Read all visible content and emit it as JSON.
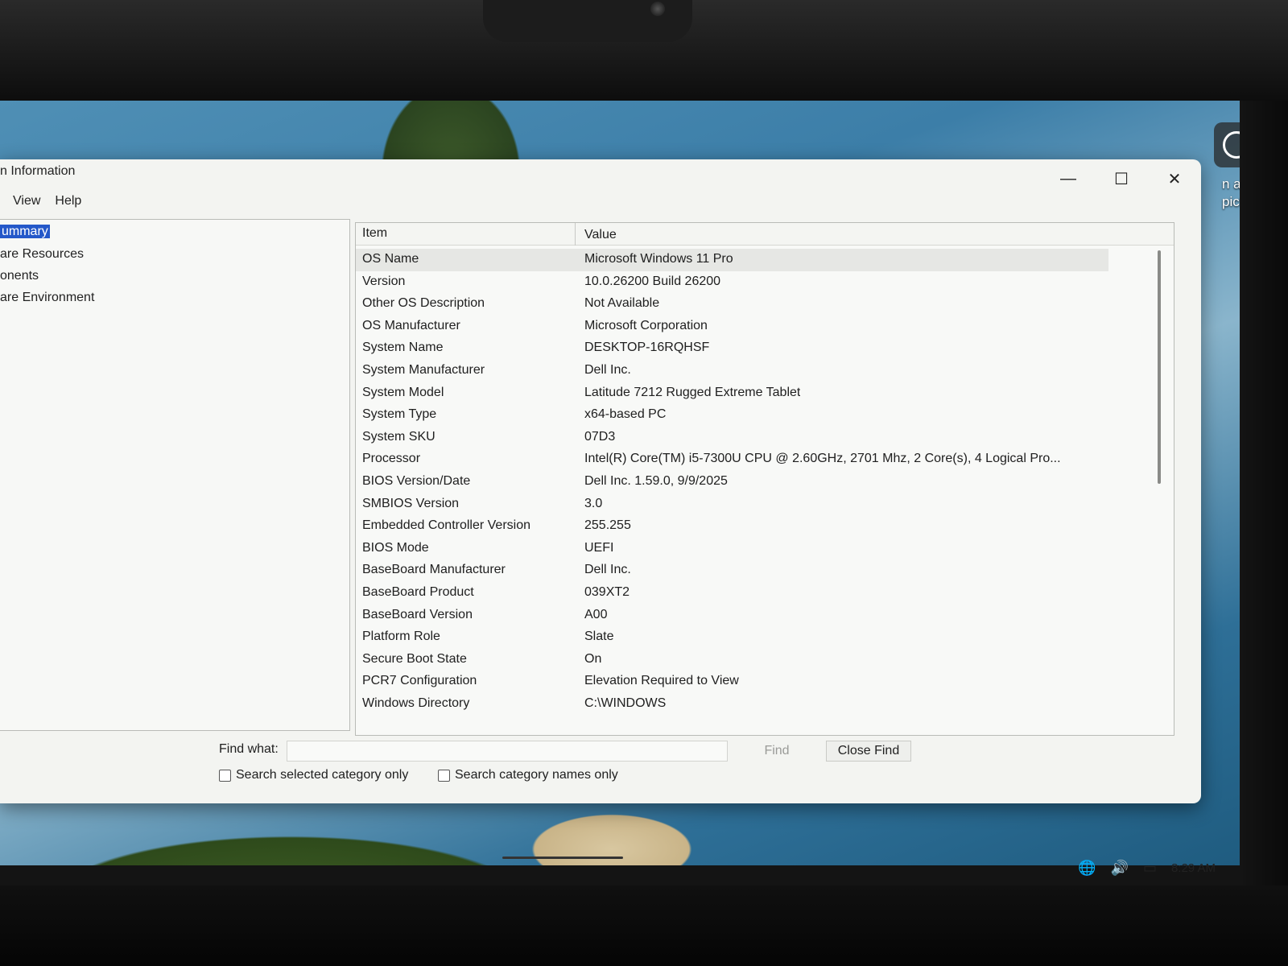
{
  "window": {
    "title": "n Information",
    "menu": [
      "View",
      "Help"
    ],
    "controls": {
      "minimize": "—",
      "maximize": "☐",
      "close": "✕"
    }
  },
  "tree": {
    "items": [
      {
        "label": "ummary",
        "selected": true
      },
      {
        "label": "are Resources",
        "selected": false
      },
      {
        "label": "onents",
        "selected": false
      },
      {
        "label": "are Environment",
        "selected": false
      }
    ]
  },
  "list": {
    "headers": {
      "item": "Item",
      "value": "Value"
    },
    "rows": [
      {
        "item": "OS Name",
        "value": "Microsoft Windows 11 Pro"
      },
      {
        "item": "Version",
        "value": "10.0.26200 Build 26200"
      },
      {
        "item": "Other OS Description",
        "value": "Not Available"
      },
      {
        "item": "OS Manufacturer",
        "value": "Microsoft Corporation"
      },
      {
        "item": "System Name",
        "value": "DESKTOP-16RQHSF"
      },
      {
        "item": "System Manufacturer",
        "value": "Dell Inc."
      },
      {
        "item": "System Model",
        "value": "Latitude 7212 Rugged Extreme Tablet"
      },
      {
        "item": "System Type",
        "value": "x64-based PC"
      },
      {
        "item": "System SKU",
        "value": "07D3"
      },
      {
        "item": "Processor",
        "value": "Intel(R) Core(TM) i5-7300U CPU @ 2.60GHz, 2701 Mhz, 2 Core(s), 4 Logical Pro..."
      },
      {
        "item": "BIOS Version/Date",
        "value": "Dell Inc. 1.59.0, 9/9/2025"
      },
      {
        "item": "SMBIOS Version",
        "value": "3.0"
      },
      {
        "item": "Embedded Controller Version",
        "value": "255.255"
      },
      {
        "item": "BIOS Mode",
        "value": "UEFI"
      },
      {
        "item": "BaseBoard Manufacturer",
        "value": "Dell Inc."
      },
      {
        "item": "BaseBoard Product",
        "value": "039XT2"
      },
      {
        "item": "BaseBoard Version",
        "value": "A00"
      },
      {
        "item": "Platform Role",
        "value": "Slate"
      },
      {
        "item": "Secure Boot State",
        "value": "On"
      },
      {
        "item": "PCR7 Configuration",
        "value": "Elevation Required to View"
      },
      {
        "item": "Windows Directory",
        "value": "C:\\WINDOWS"
      }
    ]
  },
  "find": {
    "label": "Find what:",
    "value": "",
    "find_button": "Find",
    "close_button": "Close Find",
    "check_selected": "Search selected category only",
    "check_names": "Search category names only"
  },
  "desktop": {
    "learn_label": "n about picture"
  },
  "taskbar": {
    "time": "8:29 AM",
    "icons": [
      "network-icon",
      "volume-icon",
      "battery-icon"
    ]
  }
}
